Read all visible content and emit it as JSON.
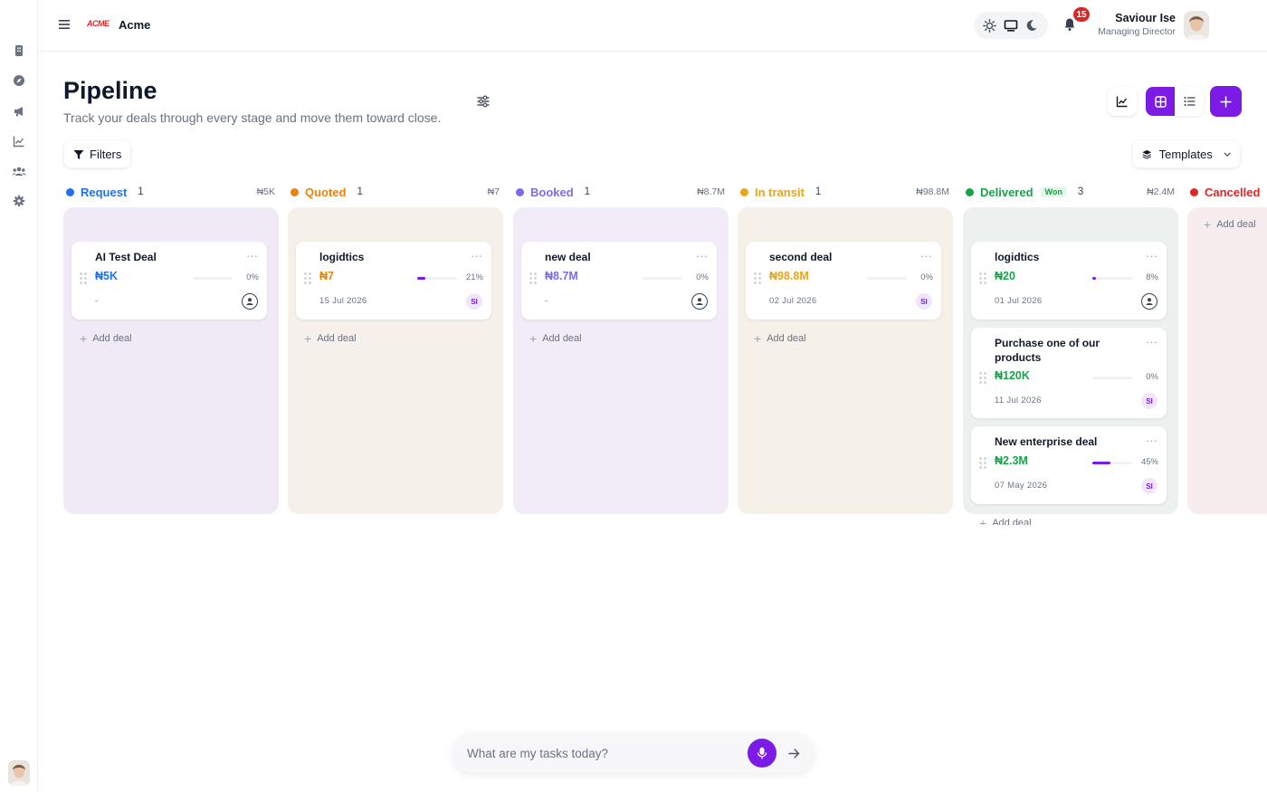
{
  "app": {
    "brand_logo": "ACME",
    "brand_name": "Acme",
    "notification_count": "15",
    "accent_color": "#7c1ae6"
  },
  "user": {
    "name": "Saviour Ise",
    "role": "Managing Director"
  },
  "sidebar": {
    "icons": [
      "building-icon",
      "compass-icon",
      "megaphone-icon",
      "trend-chart-icon",
      "users-icon",
      "settings-gear-icon"
    ]
  },
  "header": {
    "title": "Pipeline",
    "subtitle": "Track your deals through every stage and move them toward close."
  },
  "toolbar": {
    "filters_label": "Filters",
    "templates_label": "Templates"
  },
  "columns": [
    {
      "name": "Request",
      "count": "1",
      "total": "₦5K",
      "color": "#1d72f2",
      "bg": "#efeaf6",
      "add_label": "Add deal",
      "deals": [
        {
          "title": "AI Test Deal",
          "amount": "₦5K",
          "progress": 0,
          "pct_label": "0%",
          "date": "-",
          "owner": ""
        }
      ]
    },
    {
      "name": "Quoted",
      "count": "1",
      "total": "₦7",
      "color": "#e8830c",
      "bg": "#f5f0ea",
      "add_label": "Add deal",
      "deals": [
        {
          "title": "logidtics",
          "amount": "₦7",
          "progress": 21,
          "pct_label": "21%",
          "date": "15 Jul 2026",
          "owner": "SI"
        }
      ]
    },
    {
      "name": "Booked",
      "count": "1",
      "total": "₦8.7M",
      "color": "#7a6cf0",
      "bg": "#f1ecf7",
      "add_label": "Add deal",
      "deals": [
        {
          "title": "new deal",
          "amount": "₦8.7M",
          "progress": 0,
          "pct_label": "0%",
          "date": "-",
          "owner": ""
        }
      ]
    },
    {
      "name": "In transit",
      "count": "1",
      "total": "₦98.8M",
      "color": "#eaa418",
      "bg": "#f6f1e8",
      "add_label": "Add deal",
      "deals": [
        {
          "title": "second deal",
          "amount": "₦98.8M",
          "progress": 0,
          "pct_label": "0%",
          "date": "02 Jul 2026",
          "owner": "SI"
        }
      ]
    },
    {
      "name": "Delivered",
      "won_label": "Won",
      "count": "3",
      "total": "₦2.4M",
      "color": "#16a34a",
      "bg": "#ecf1ef",
      "add_label": "Add deal",
      "deals": [
        {
          "title": "logidtics",
          "amount": "₦20",
          "progress": 8,
          "pct_label": "8%",
          "date": "01 Jul 2026",
          "owner": ""
        },
        {
          "title": "Purchase one of our products",
          "amount": "₦120K",
          "progress": 0,
          "pct_label": "0%",
          "date": "11 Jul 2026",
          "owner": "SI"
        },
        {
          "title": "New enterprise deal",
          "amount": "₦2.3M",
          "progress": 45,
          "pct_label": "45%",
          "date": "07 May 2026",
          "owner": "SI"
        }
      ]
    },
    {
      "name": "Cancelled",
      "color": "#dc2626",
      "bg": "#f7ecee",
      "add_label": "Add deal",
      "deals": []
    }
  ],
  "chat": {
    "placeholder": "What are my tasks today?"
  }
}
